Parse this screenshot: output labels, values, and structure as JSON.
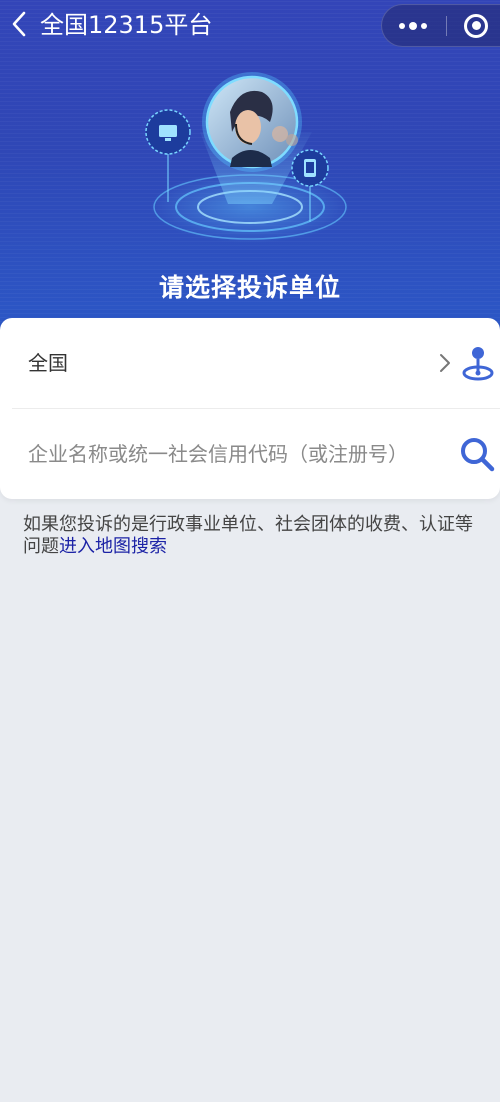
{
  "nav": {
    "back_icon": "chevron-left-icon",
    "title": "全国12315平台",
    "more_icon": "more-dots-icon",
    "close_icon": "target-circle-icon"
  },
  "hero": {
    "headline": "请选择投诉单位",
    "illustration": "customer-service-operators",
    "icons": [
      "monitor-icon",
      "phone-icon"
    ]
  },
  "form": {
    "region_value": "全国",
    "region_chevron_icon": "chevron-right-icon",
    "location_icon": "map-pin-icon",
    "search_placeholder": "企业名称或统一社会信用代码（或注册号）",
    "search_value": "",
    "search_icon": "search-icon"
  },
  "note": {
    "text": "如果您投诉的是行政事业单位、社会团体的收费、认证等问题",
    "link": "进入地图搜索"
  },
  "colors": {
    "hero_top": "#3345b8",
    "hero_bottom": "#2c57c6",
    "accent_blue": "#3f66d6",
    "link": "#1c23a6",
    "background": "#e9ecf1"
  }
}
